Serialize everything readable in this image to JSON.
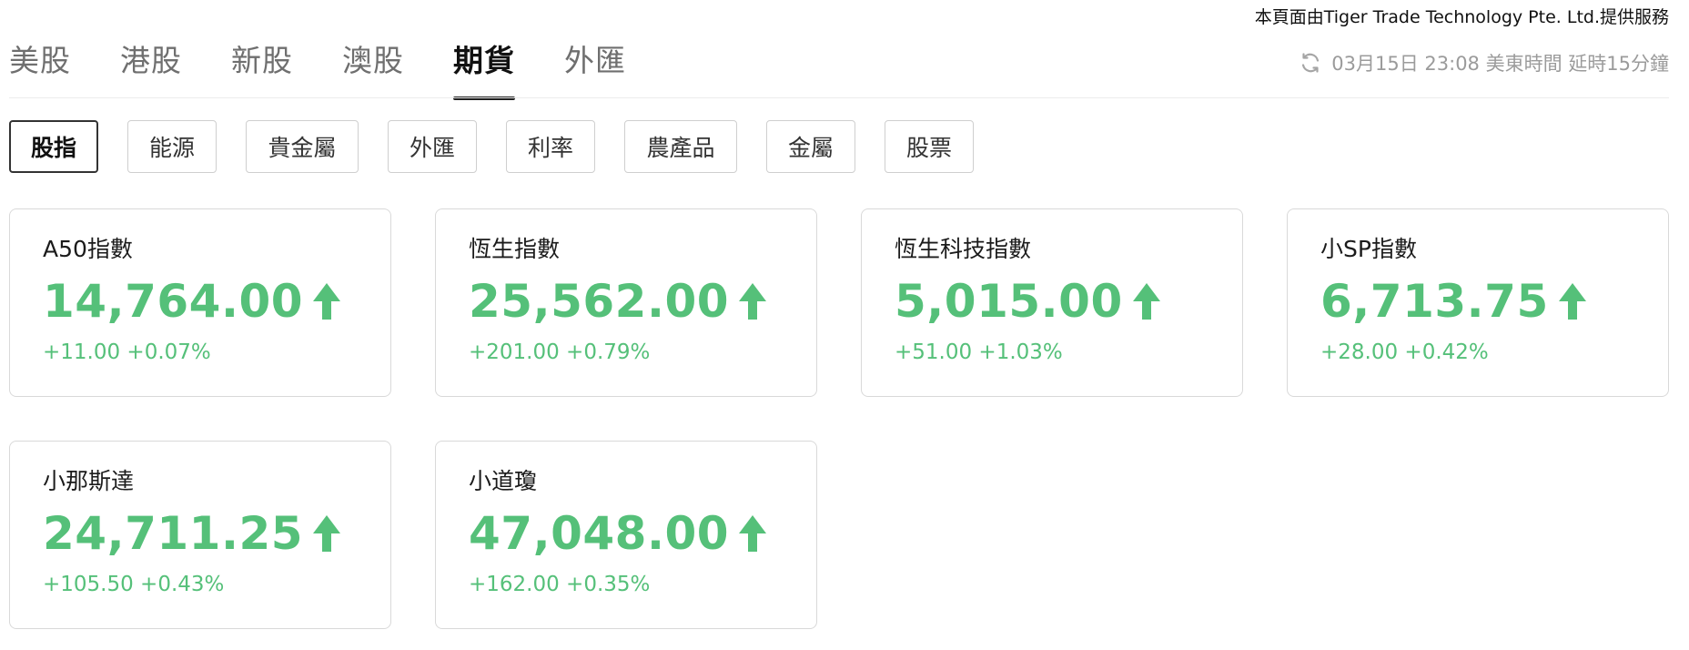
{
  "attribution": "本頁面由Tiger Trade Technology Pte. Ltd.提供服務",
  "colors": {
    "up_green": "#55c079",
    "active_text": "#111111",
    "muted_text": "#6f6f6f",
    "border": "#d9d9d9"
  },
  "tabs": [
    {
      "label": "美股",
      "active": false
    },
    {
      "label": "港股",
      "active": false
    },
    {
      "label": "新股",
      "active": false
    },
    {
      "label": "澳股",
      "active": false
    },
    {
      "label": "期貨",
      "active": true
    },
    {
      "label": "外匯",
      "active": false
    }
  ],
  "update": {
    "icon": "refresh-icon",
    "text": "03月15日 23:08 美東時間 延時15分鐘"
  },
  "categories": [
    {
      "label": "股指",
      "active": true
    },
    {
      "label": "能源",
      "active": false
    },
    {
      "label": "貴金屬",
      "active": false
    },
    {
      "label": "外匯",
      "active": false
    },
    {
      "label": "利率",
      "active": false
    },
    {
      "label": "農產品",
      "active": false
    },
    {
      "label": "金屬",
      "active": false
    },
    {
      "label": "股票",
      "active": false
    }
  ],
  "futures": [
    {
      "name": "A50指數",
      "price": "14,764.00",
      "change": "+11.00 +0.07%",
      "direction": "up-arrow-icon"
    },
    {
      "name": "恆生指數",
      "price": "25,562.00",
      "change": "+201.00 +0.79%",
      "direction": "up-arrow-icon"
    },
    {
      "name": "恆生科技指數",
      "price": "5,015.00",
      "change": "+51.00 +1.03%",
      "direction": "up-arrow-icon"
    },
    {
      "name": "小SP指數",
      "price": "6,713.75",
      "change": "+28.00 +0.42%",
      "direction": "up-arrow-icon"
    },
    {
      "name": "小那斯達",
      "price": "24,711.25",
      "change": "+105.50 +0.43%",
      "direction": "up-arrow-icon"
    },
    {
      "name": "小道瓊",
      "price": "47,048.00",
      "change": "+162.00 +0.35%",
      "direction": "up-arrow-icon"
    }
  ]
}
